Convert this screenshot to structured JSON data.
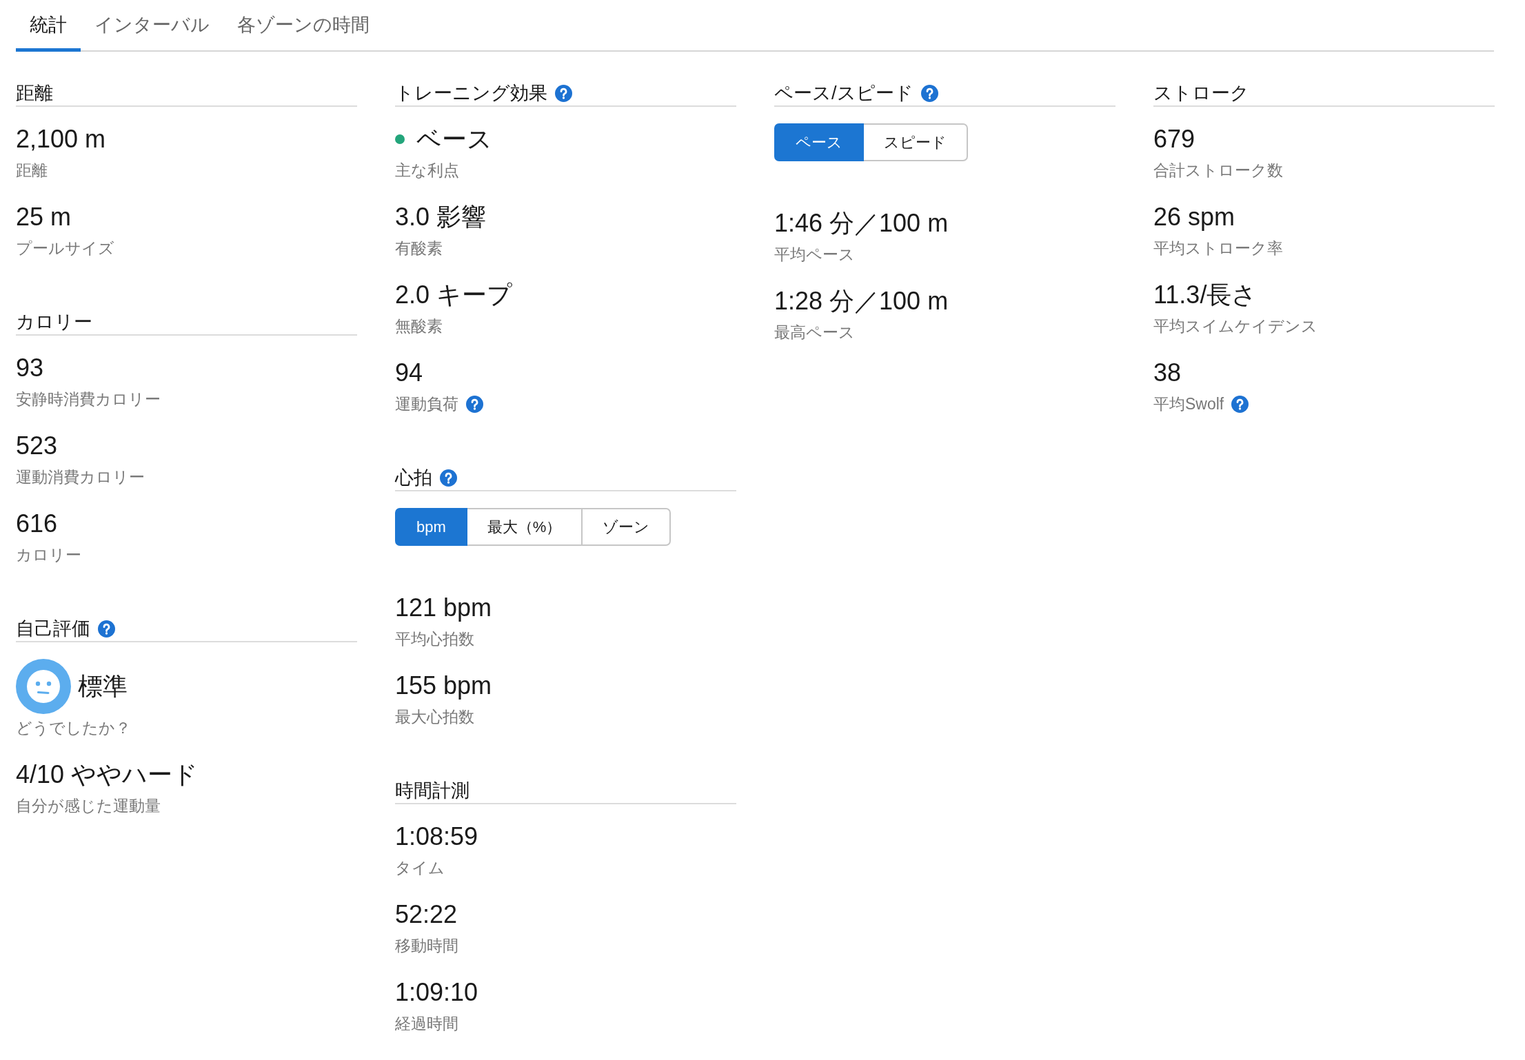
{
  "tabs": [
    {
      "label": "統計",
      "selected": true
    },
    {
      "label": "インターバル",
      "selected": false
    },
    {
      "label": "各ゾーンの時間",
      "selected": false
    }
  ],
  "columns": [
    {
      "sections": [
        {
          "title": "距離",
          "help": false,
          "items": [
            {
              "kind": "stat",
              "value": "2,100 m",
              "label": "距離",
              "help": false
            },
            {
              "kind": "stat",
              "value": "25 m",
              "label": "プールサイズ",
              "help": false
            }
          ]
        },
        {
          "title": "カロリー",
          "help": false,
          "items": [
            {
              "kind": "stat",
              "value": "93",
              "label": "安静時消費カロリー",
              "help": false
            },
            {
              "kind": "stat",
              "value": "523",
              "label": "運動消費カロリー",
              "help": false
            },
            {
              "kind": "stat",
              "value": "616",
              "label": "カロリー",
              "help": false
            }
          ]
        },
        {
          "title": "自己評価",
          "help": true,
          "items": [
            {
              "kind": "face",
              "value": "標準",
              "label": "どうでしたか？",
              "help": false
            },
            {
              "kind": "stat",
              "value": "4/10 ややハード",
              "label": "自分が感じた運動量",
              "help": false
            }
          ]
        }
      ]
    },
    {
      "sections": [
        {
          "title": "トレーニング効果",
          "help": true,
          "items": [
            {
              "kind": "indicator",
              "color": "#23a57b",
              "value": "ベース",
              "label": "主な利点",
              "help": false
            },
            {
              "kind": "stat",
              "value": "3.0 影響",
              "label": "有酸素",
              "help": false
            },
            {
              "kind": "stat",
              "value": "2.0 キープ",
              "label": "無酸素",
              "help": false
            },
            {
              "kind": "stat",
              "value": "94",
              "label": "運動負荷",
              "help": true
            }
          ]
        },
        {
          "title": "心拍",
          "help": true,
          "items": [
            {
              "kind": "toggle",
              "options": [
                {
                  "label": "bpm",
                  "selected": true
                },
                {
                  "label": "最大（%）",
                  "selected": false
                },
                {
                  "label": "ゾーン",
                  "selected": false
                }
              ]
            },
            {
              "kind": "stat",
              "value": "121 bpm",
              "label": "平均心拍数",
              "help": false
            },
            {
              "kind": "stat",
              "value": "155 bpm",
              "label": "最大心拍数",
              "help": false
            }
          ]
        },
        {
          "title": "時間計測",
          "help": false,
          "items": [
            {
              "kind": "stat",
              "value": "1:08:59",
              "label": "タイム",
              "help": false
            },
            {
              "kind": "stat",
              "value": "52:22",
              "label": "移動時間",
              "help": false
            },
            {
              "kind": "stat",
              "value": "1:09:10",
              "label": "経過時間",
              "help": false
            }
          ]
        }
      ]
    },
    {
      "sections": [
        {
          "title": "ペース/スピード",
          "help": true,
          "items": [
            {
              "kind": "toggle",
              "options": [
                {
                  "label": "ペース",
                  "selected": true
                },
                {
                  "label": "スピード",
                  "selected": false
                }
              ]
            },
            {
              "kind": "stat",
              "value": "1:46 分／100 m",
              "label": "平均ペース",
              "help": false
            },
            {
              "kind": "stat",
              "value": "1:28 分／100 m",
              "label": "最高ペース",
              "help": false
            }
          ]
        }
      ]
    },
    {
      "sections": [
        {
          "title": "ストローク",
          "help": false,
          "items": [
            {
              "kind": "stat",
              "value": "679",
              "label": "合計ストローク数",
              "help": false
            },
            {
              "kind": "stat",
              "value": "26 spm",
              "label": "平均ストローク率",
              "help": false
            },
            {
              "kind": "stat",
              "value": "11.3/長さ",
              "label": "平均スイムケイデンス",
              "help": false
            },
            {
              "kind": "stat",
              "value": "38",
              "label": "平均Swolf",
              "help": true
            }
          ]
        }
      ]
    }
  ]
}
